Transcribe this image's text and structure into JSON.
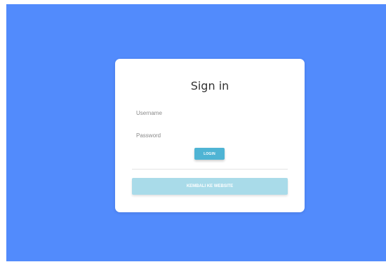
{
  "colors": {
    "background": "#528bfc",
    "card": "#ffffff",
    "login_button": "#4fb4d4",
    "back_button": "#a9dbe9"
  },
  "form": {
    "title": "Sign in",
    "username_placeholder": "Username",
    "password_placeholder": "Password",
    "login_label": "LOGIN",
    "back_label": "KEMBALI KE WEBSITE"
  }
}
